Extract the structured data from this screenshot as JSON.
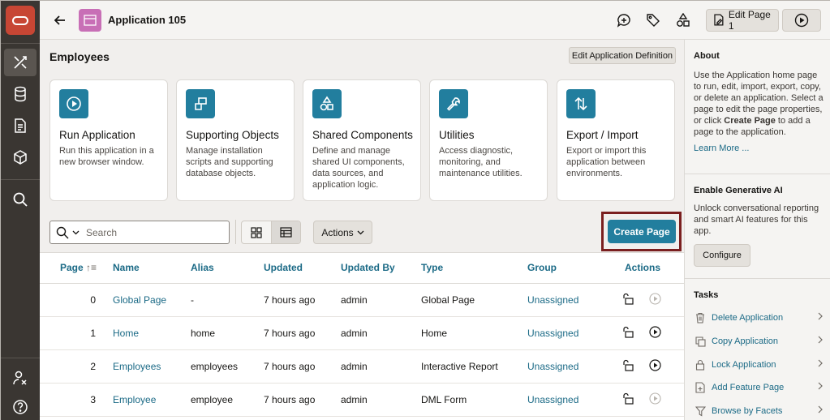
{
  "app": {
    "title": "Application 105"
  },
  "header": {
    "edit_page_label": "Edit Page 1"
  },
  "region": {
    "title": "Employees",
    "edit_definition_label": "Edit Application Definition"
  },
  "cards": [
    {
      "title": "Run Application",
      "desc": "Run this application in a new browser window.",
      "icon": "play-icon"
    },
    {
      "title": "Supporting Objects",
      "desc": "Manage installation scripts and supporting database objects.",
      "icon": "supporting-objects-icon"
    },
    {
      "title": "Shared Components",
      "desc": "Define and manage shared UI components, data sources, and application logic.",
      "icon": "shapes-icon"
    },
    {
      "title": "Utilities",
      "desc": "Access diagnostic, monitoring, and maintenance utilities.",
      "icon": "wrench-icon"
    },
    {
      "title": "Export / Import",
      "desc": "Export or import this application between environments.",
      "icon": "arrows-up-down-icon"
    }
  ],
  "toolbar": {
    "search_placeholder": "Search",
    "actions_label": "Actions",
    "create_page_label": "Create Page"
  },
  "table": {
    "columns": [
      "Page",
      "Name",
      "Alias",
      "Updated",
      "Updated By",
      "Type",
      "Group",
      "Actions"
    ],
    "rows": [
      {
        "page": "0",
        "name": "Global Page",
        "alias": "-",
        "updated": "7 hours ago",
        "updated_by": "admin",
        "type": "Global Page",
        "group": "Unassigned",
        "run_enabled": false
      },
      {
        "page": "1",
        "name": "Home",
        "alias": "home",
        "updated": "7 hours ago",
        "updated_by": "admin",
        "type": "Home",
        "group": "Unassigned",
        "run_enabled": true
      },
      {
        "page": "2",
        "name": "Employees",
        "alias": "employees",
        "updated": "7 hours ago",
        "updated_by": "admin",
        "type": "Interactive Report",
        "group": "Unassigned",
        "run_enabled": true
      },
      {
        "page": "3",
        "name": "Employee",
        "alias": "employee",
        "updated": "7 hours ago",
        "updated_by": "admin",
        "type": "DML Form",
        "group": "Unassigned",
        "run_enabled": false
      }
    ]
  },
  "sidebar": {
    "about": {
      "title": "About",
      "text_1": "Use the Application home page to run, edit, import, export, copy, or delete an application. Select a page to edit the page properties, or click ",
      "text_bold": "Create Page",
      "text_2": " to add a page to the application.",
      "link": "Learn More ..."
    },
    "genai": {
      "title": "Enable Generative AI",
      "text": "Unlock conversational reporting and smart AI features for this app.",
      "button": "Configure"
    },
    "tasks": {
      "title": "Tasks",
      "items": [
        {
          "label": "Delete Application",
          "icon": "trash-icon"
        },
        {
          "label": "Copy Application",
          "icon": "copy-icon"
        },
        {
          "label": "Lock Application",
          "icon": "lock-icon"
        },
        {
          "label": "Add Feature Page",
          "icon": "add-page-icon"
        },
        {
          "label": "Browse by Facets",
          "icon": "filter-icon"
        }
      ]
    }
  },
  "colors": {
    "accent": "#227e9e",
    "link": "#1b6a86",
    "rail": "#3a3632",
    "brand": "#c74634",
    "highlight": "#7a1f1f"
  }
}
